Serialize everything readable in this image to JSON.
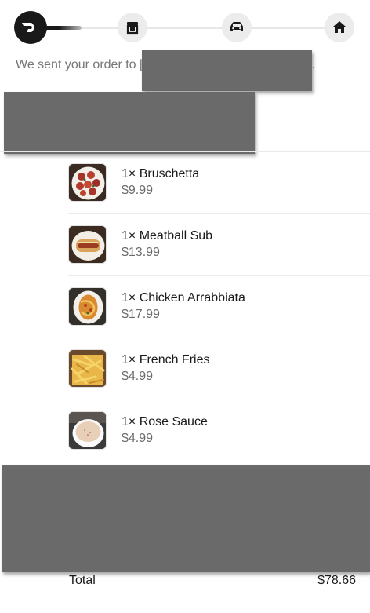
{
  "tracker": {
    "steps": [
      {
        "icon": "doordash-logo-icon",
        "state": "active"
      },
      {
        "icon": "store-icon",
        "state": "pending"
      },
      {
        "icon": "car-icon",
        "state": "pending"
      },
      {
        "icon": "home-icon",
        "state": "pending"
      }
    ],
    "accent": "#191919"
  },
  "message": {
    "text": "We sent your order to [redacted] for final confirmation."
  },
  "order_items": [
    {
      "name": "1× Bruschetta",
      "price": "$9.99",
      "image": "bruschetta"
    },
    {
      "name": "1× Meatball Sub",
      "price": "$13.99",
      "image": "meatball-sub"
    },
    {
      "name": "1× Chicken Arrabbiata",
      "price": "$17.99",
      "image": "chicken-arrabbiata"
    },
    {
      "name": "1× French Fries",
      "price": "$4.99",
      "image": "french-fries"
    },
    {
      "name": "1× Rose Sauce",
      "price": "$4.99",
      "image": "rose-sauce"
    }
  ],
  "summary": {
    "total_label": "Total",
    "total_value": "$78.66"
  }
}
